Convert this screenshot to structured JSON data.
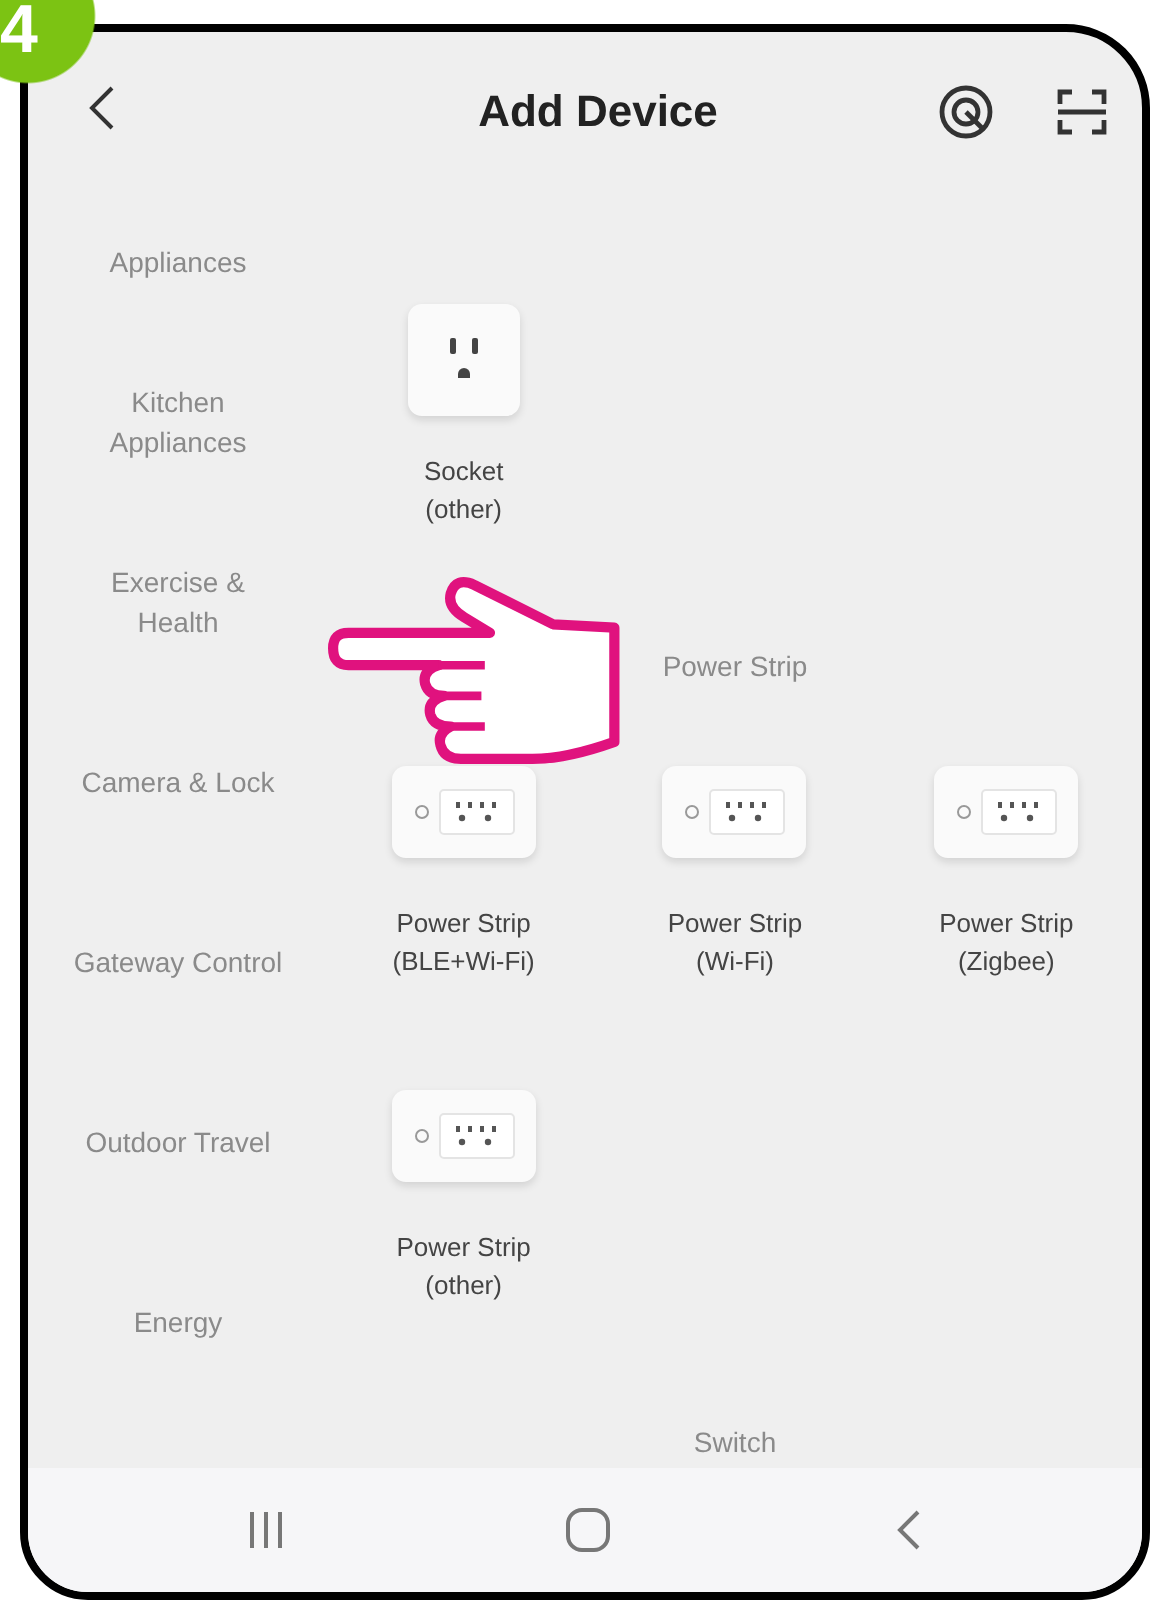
{
  "step_badge": "4",
  "header": {
    "title": "Add Device"
  },
  "categories": [
    {
      "label": "Appliances"
    },
    {
      "label": "Kitchen Appliances"
    },
    {
      "label": "Exercise & Health"
    },
    {
      "label": "Camera & Lock"
    },
    {
      "label": "Gateway Control"
    },
    {
      "label": "Outdoor Travel"
    },
    {
      "label": "Energy"
    }
  ],
  "sections": [
    {
      "items": [
        {
          "kind": "socket",
          "label": "Socket\n(other)"
        }
      ]
    },
    {
      "title": "Power Strip",
      "items": [
        {
          "kind": "strip",
          "label": "Power Strip\n(BLE+Wi-Fi)"
        },
        {
          "kind": "strip",
          "label": "Power Strip\n(Wi-Fi)"
        },
        {
          "kind": "strip",
          "label": "Power Strip\n(Zigbee)"
        },
        {
          "kind": "strip",
          "label": "Power Strip\n(other)"
        }
      ]
    },
    {
      "title": "Switch"
    }
  ]
}
